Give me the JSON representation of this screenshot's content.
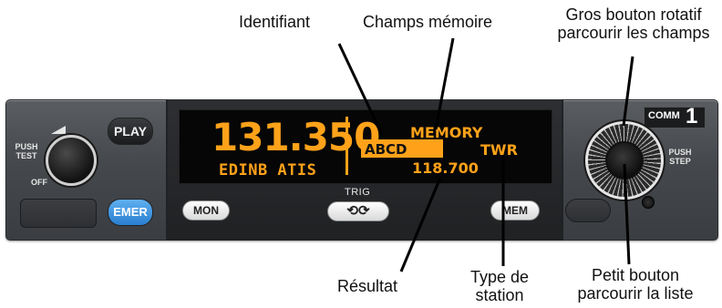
{
  "callouts": {
    "identifiant": "Identifiant",
    "champs_memoire": "Champs mémoire",
    "gros_bouton_line1": "Gros bouton rotatif",
    "gros_bouton_line2": "parcourir les champs",
    "resultat": "Résultat",
    "type_line1": "Type de",
    "type_line2": "station",
    "petit_bouton_line1": "Petit bouton",
    "petit_bouton_line2": "parcourir la liste"
  },
  "display": {
    "active_frequency": "131.350",
    "station_ident": "EDINB  ATIS",
    "memory_title": "MEMORY",
    "memory_ident": "ABCD",
    "station_type": "TWR",
    "result_frequency": "118.700"
  },
  "buttons": {
    "play": "PLAY",
    "emer": "EMER",
    "mon": "MON",
    "trig": "TRIG",
    "trig_symbol": "⟲⟳",
    "mem": "MEM"
  },
  "panel_labels": {
    "push": "PUSH",
    "test": "TEST",
    "off": "OFF",
    "push_step_1": "PUSH",
    "push_step_2": "STEP",
    "comm": "COMM",
    "comm_number": "1"
  },
  "colors": {
    "display_amber": "#ffa21a",
    "emer_blue": "#2a7fd0",
    "panel_gray": "#45484c"
  },
  "icons": {
    "volume_knob": "volume-knob-icon",
    "trig_swap": "swap-arrows-icon",
    "led": "indicator-led-icon"
  }
}
